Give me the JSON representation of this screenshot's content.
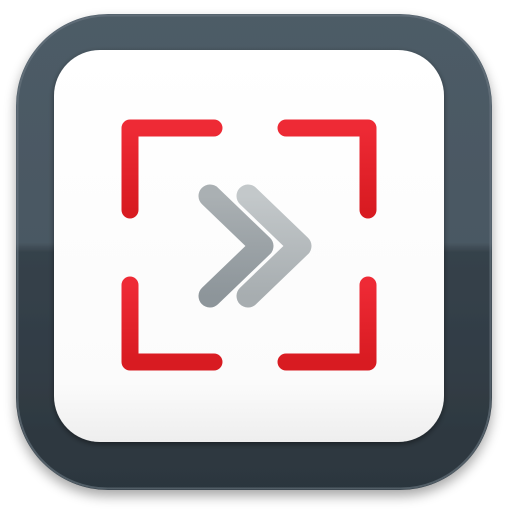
{
  "icon": {
    "name": "fast-forward-frame-icon",
    "frame_color": "#e31e24",
    "chevron_color": "#9aa2a6",
    "bezel_color": "#3b4852",
    "tile_color": "#ffffff"
  }
}
